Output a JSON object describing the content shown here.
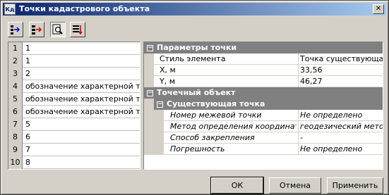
{
  "window": {
    "icon_label": "Кд",
    "title": "Точки кадастрового объекта",
    "close_glyph": "✕"
  },
  "toolbar": {
    "icons": [
      "insert-point-icon",
      "move-point-icon",
      "zoom-point-icon",
      "renumber-icon"
    ]
  },
  "points_list": [
    {
      "num": "1",
      "label": "1"
    },
    {
      "num": "2",
      "label": "1"
    },
    {
      "num": "3",
      "label": "2"
    },
    {
      "num": "4",
      "label": "обозначение характерной т..."
    },
    {
      "num": "5",
      "label": "обозначение характерной точки"
    },
    {
      "num": "6",
      "label": "обозначение характерной точки"
    },
    {
      "num": "7",
      "label": "5"
    },
    {
      "num": "8",
      "label": "6"
    },
    {
      "num": "9",
      "label": "7"
    },
    {
      "num": "10",
      "label": "8"
    }
  ],
  "properties": {
    "cat_point_params": "Параметры точки",
    "style_label": "Стиль элемента",
    "style_value": "Точка существующая",
    "x_label": "X, м",
    "x_value": "33,56",
    "y_label": "Y, м",
    "y_value": "46,27",
    "cat_point_object": "Точечный объект",
    "cat_existing_point": "Существующая точка",
    "boundary_label": "Номер межевой точки",
    "boundary_value": "Не определено",
    "method_label": "Метод определения координат",
    "method_value": "геодезический метод",
    "fixation_label": "Способ закрепления",
    "fixation_value": "-",
    "error_label": "Погрешность",
    "error_value": "Не определено",
    "toggle_glyph": "−"
  },
  "buttons": {
    "ok": "ОК",
    "cancel": "Отмена",
    "apply": "Применить"
  }
}
